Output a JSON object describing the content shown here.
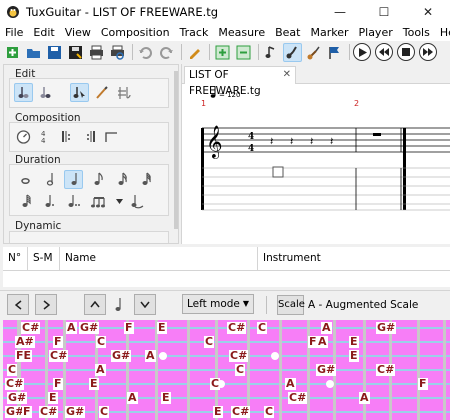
{
  "window": {
    "title": "TuxGuitar - LIST OF FREEWARE.tg",
    "minimize": "—",
    "maximize": "☐",
    "close": "✕"
  },
  "menu": [
    "File",
    "Edit",
    "View",
    "Composition",
    "Track",
    "Measure",
    "Beat",
    "Marker",
    "Player",
    "Tools",
    "Help"
  ],
  "left_panel": {
    "edit_label": "Edit",
    "composition_label": "Composition",
    "duration_label": "Duration",
    "dynamic_label": "Dynamic"
  },
  "editor": {
    "tab_label": "LIST OF FREEWARE.tg",
    "tab_close": "✕",
    "tempo": "= 120",
    "measure_1": "1",
    "measure_2": "2"
  },
  "track_table": {
    "headers": [
      "N°",
      "S-M",
      "Name",
      "Instrument"
    ]
  },
  "fretboard_bar": {
    "mode": "Left mode",
    "scale_button": "Scale",
    "scale_name": "A - Augmented Scale"
  },
  "fretboard": {
    "notes": [
      {
        "label": "C#",
        "string": 0,
        "col": 0
      },
      {
        "label": "A",
        "string": 0,
        "col": 1
      },
      {
        "label": "G#",
        "string": 0,
        "col": 2
      },
      {
        "label": "F",
        "string": 0,
        "col": 3
      },
      {
        "label": "E",
        "string": 0,
        "col": 4
      },
      {
        "label": "C#",
        "string": 0,
        "col": 5
      },
      {
        "label": "C",
        "string": 0,
        "col": 6
      },
      {
        "label": "A",
        "string": 0,
        "col": 7
      },
      {
        "label": "G#",
        "string": 0,
        "col": 8
      },
      {
        "label": "A#",
        "string": 1,
        "col": 0
      },
      {
        "label": "F",
        "string": 1,
        "col": 1
      },
      {
        "label": "C",
        "string": 1,
        "col": 2
      },
      {
        "label": "C",
        "string": 1,
        "col": 3
      },
      {
        "label": "A",
        "string": 1,
        "col": 4
      },
      {
        "label": "E",
        "string": 1,
        "col": 5
      },
      {
        "label": "F",
        "string": 1,
        "col": 6
      },
      {
        "label": "FE",
        "string": 2,
        "col": 0
      },
      {
        "label": "C#",
        "string": 2,
        "col": 1
      },
      {
        "label": "G#",
        "string": 2,
        "col": 2
      },
      {
        "label": "A",
        "string": 2,
        "col": 3
      },
      {
        "label": "C#",
        "string": 2,
        "col": 4
      },
      {
        "label": "E",
        "string": 2,
        "col": 5
      },
      {
        "label": "C",
        "string": 3,
        "col": 0
      },
      {
        "label": "A",
        "string": 3,
        "col": 1
      },
      {
        "label": "C",
        "string": 3,
        "col": 2
      },
      {
        "label": "G#",
        "string": 3,
        "col": 3
      },
      {
        "label": "C#",
        "string": 3,
        "col": 4
      },
      {
        "label": "C#",
        "string": 4,
        "col": 0
      },
      {
        "label": "F",
        "string": 4,
        "col": 1
      },
      {
        "label": "E",
        "string": 4,
        "col": 2
      },
      {
        "label": "C",
        "string": 4,
        "col": 3
      },
      {
        "label": "A",
        "string": 4,
        "col": 4
      },
      {
        "label": "F",
        "string": 4,
        "col": 5
      },
      {
        "label": "G#",
        "string": 5,
        "col": 0
      },
      {
        "label": "E",
        "string": 5,
        "col": 1
      },
      {
        "label": "A",
        "string": 5,
        "col": 2
      },
      {
        "label": "E",
        "string": 5,
        "col": 3
      },
      {
        "label": "C#",
        "string": 5,
        "col": 4
      },
      {
        "label": "A",
        "string": 5,
        "col": 5
      },
      {
        "label": "G#",
        "string": 6,
        "col": 0
      },
      {
        "label": "F",
        "string": 6,
        "col": 1
      },
      {
        "label": "C#",
        "string": 6,
        "col": 2
      },
      {
        "label": "G#",
        "string": 6,
        "col": 3
      },
      {
        "label": "C",
        "string": 6,
        "col": 4
      },
      {
        "label": "E",
        "string": 6,
        "col": 5
      },
      {
        "label": "C#",
        "string": 6,
        "col": 6
      },
      {
        "label": "C",
        "string": 6,
        "col": 7
      }
    ]
  },
  "colors": {
    "fretboard_bg": "#f77ef7",
    "note_text": "#8b1a1a",
    "selected_bg": "#cce4f7"
  }
}
